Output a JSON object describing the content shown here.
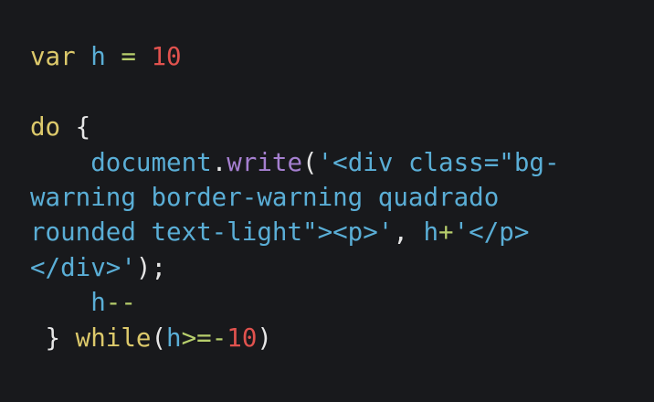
{
  "colors": {
    "background": "#18191c",
    "keyword": "#dcc96b",
    "identifier": "#5aaed6",
    "operator": "#b7ce6c",
    "number": "#e0524e",
    "function": "#a57fd0",
    "string": "#5aaed6",
    "punctuation": "#e6e6e6"
  },
  "code": {
    "lines": [
      [
        {
          "t": "var",
          "k": "kw"
        },
        {
          "t": " ",
          "k": "punc"
        },
        {
          "t": "h",
          "k": "id"
        },
        {
          "t": " ",
          "k": "punc"
        },
        {
          "t": "=",
          "k": "op"
        },
        {
          "t": " ",
          "k": "punc"
        },
        {
          "t": "10",
          "k": "num"
        }
      ],
      [],
      [
        {
          "t": "do",
          "k": "kw"
        },
        {
          "t": " {",
          "k": "punc"
        }
      ],
      [
        {
          "t": "    ",
          "k": "punc"
        },
        {
          "t": "document",
          "k": "id"
        },
        {
          "t": ".",
          "k": "punc"
        },
        {
          "t": "write",
          "k": "fn"
        },
        {
          "t": "(",
          "k": "punc"
        },
        {
          "t": "'<div class=\"bg-",
          "k": "str"
        }
      ],
      [
        {
          "t": "warning border-warning quadrado",
          "k": "str"
        }
      ],
      [
        {
          "t": "rounded text-light\"><p>'",
          "k": "str"
        },
        {
          "t": ", ",
          "k": "punc"
        },
        {
          "t": "h",
          "k": "id"
        },
        {
          "t": "+",
          "k": "op"
        },
        {
          "t": "'</p>",
          "k": "str"
        }
      ],
      [
        {
          "t": "</div>'",
          "k": "str"
        },
        {
          "t": ");",
          "k": "punc"
        }
      ],
      [
        {
          "t": "    ",
          "k": "punc"
        },
        {
          "t": "h",
          "k": "id"
        },
        {
          "t": "--",
          "k": "op"
        }
      ],
      [
        {
          "t": " } ",
          "k": "punc"
        },
        {
          "t": "while",
          "k": "kw"
        },
        {
          "t": "(",
          "k": "punc"
        },
        {
          "t": "h",
          "k": "id"
        },
        {
          "t": ">=-",
          "k": "op"
        },
        {
          "t": "10",
          "k": "num"
        },
        {
          "t": ")",
          "k": "punc"
        }
      ]
    ]
  }
}
